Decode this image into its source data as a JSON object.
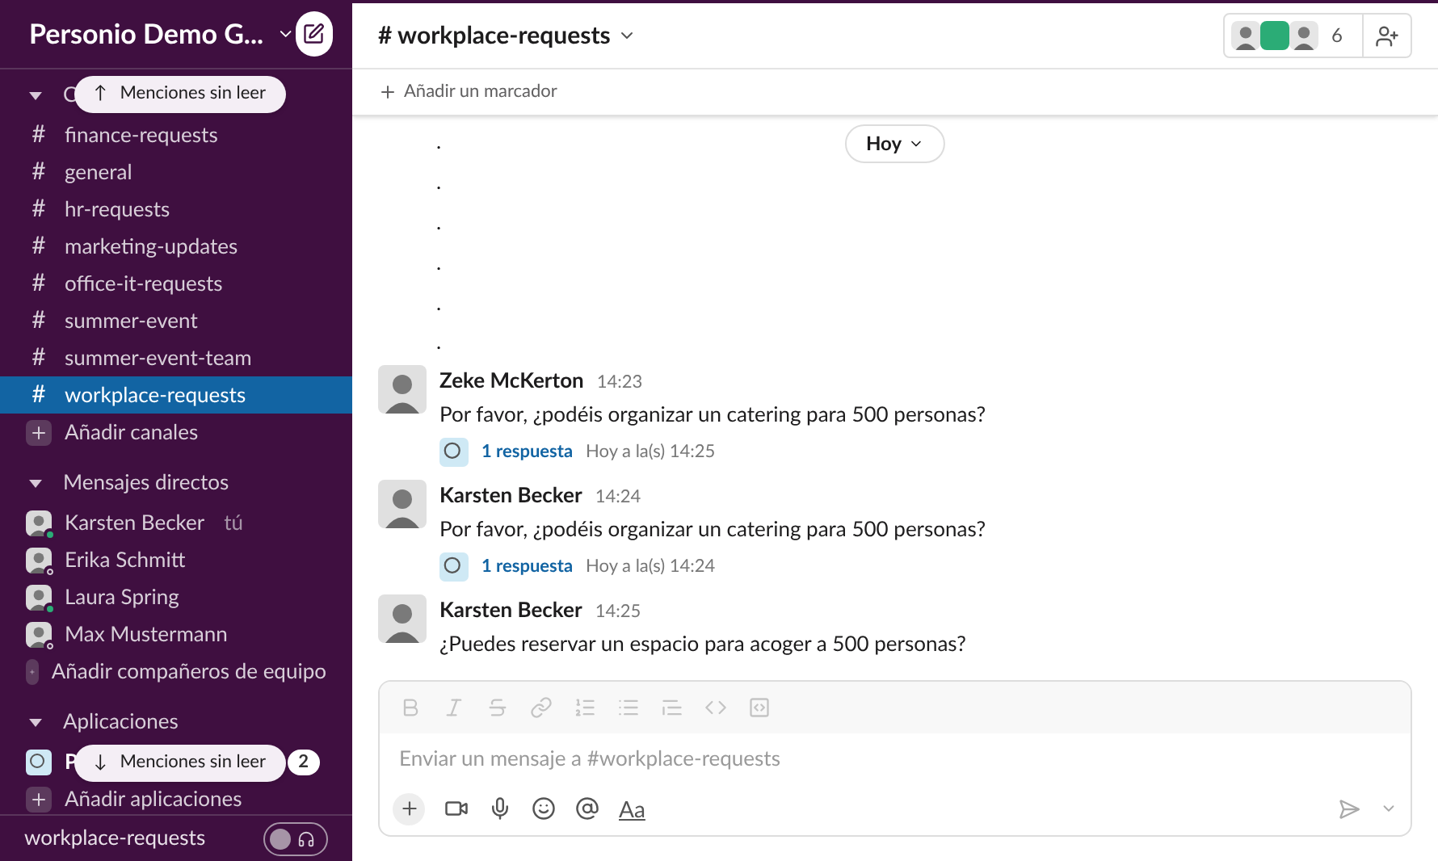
{
  "workspace": {
    "name": "Personio Demo G..."
  },
  "sections": [
    {
      "label": "C",
      "expanded": true,
      "items": [
        {
          "kind": "channel",
          "icon": "#",
          "label": "finance-requests",
          "selected": false
        },
        {
          "kind": "channel",
          "icon": "#",
          "label": "general",
          "selected": false
        },
        {
          "kind": "channel",
          "icon": "#",
          "label": "hr-requests",
          "selected": false
        },
        {
          "kind": "channel",
          "icon": "#",
          "label": "marketing-updates",
          "selected": false
        },
        {
          "kind": "channel",
          "icon": "#",
          "label": "office-it-requests",
          "selected": false
        },
        {
          "kind": "channel",
          "icon": "#",
          "label": "summer-event",
          "selected": false
        },
        {
          "kind": "channel",
          "icon": "#",
          "label": "summer-event-team",
          "selected": false
        },
        {
          "kind": "channel",
          "icon": "#",
          "label": "workplace-requests",
          "selected": true
        },
        {
          "kind": "add",
          "label": "Añadir canales",
          "selected": false
        }
      ]
    },
    {
      "label": "Mensajes directos",
      "expanded": true,
      "items": [
        {
          "kind": "person",
          "label": "Karsten Becker",
          "suffix": "tú",
          "online": true,
          "selected": false
        },
        {
          "kind": "person",
          "label": "Erika Schmitt",
          "online": false,
          "selected": false
        },
        {
          "kind": "person",
          "label": "Laura Spring",
          "online": true,
          "selected": false
        },
        {
          "kind": "person",
          "label": "Max Mustermann",
          "online": false,
          "selected": false
        },
        {
          "kind": "add",
          "label": "Añadir compañeros de equipo",
          "selected": false
        }
      ]
    },
    {
      "label": "Aplicaciones",
      "expanded": true,
      "items": [
        {
          "kind": "app",
          "label": "P",
          "badge": "2",
          "selected": false
        },
        {
          "kind": "add",
          "label": "Añadir aplicaciones",
          "selected": false
        }
      ]
    }
  ],
  "unread_top": {
    "arrow": "↑",
    "label": "Menciones sin leer"
  },
  "unread_bottom": {
    "arrow": "↓",
    "label": "Menciones sin leer"
  },
  "footer": {
    "channel": "workplace-requests",
    "huddle_on": false
  },
  "channel": {
    "name": "workplace-requests",
    "member_count": "6",
    "bookmark": "Añadir un marcador"
  },
  "date_pill": "Hoy",
  "dots": [
    ".",
    ".",
    ".",
    ".",
    ".",
    "."
  ],
  "messages": [
    {
      "author": "Zeke McKerton",
      "time": "14:23",
      "text": "Por favor, ¿podéis organizar un catering para 500 personas?",
      "replies": "1 respuesta",
      "reply_time": "Hoy a la(s) 14:25"
    },
    {
      "author": "Karsten Becker",
      "time": "14:24",
      "text": "Por favor, ¿podéis organizar un catering para 500 personas?",
      "replies": "1 respuesta",
      "reply_time": "Hoy a la(s) 14:24"
    },
    {
      "author": "Karsten Becker",
      "time": "14:25",
      "text": "¿Puedes reservar un espacio para acoger a 500 personas?"
    }
  ],
  "composer": {
    "placeholder": "Enviar un mensaje a #workplace-requests",
    "format_label": "Aa"
  }
}
